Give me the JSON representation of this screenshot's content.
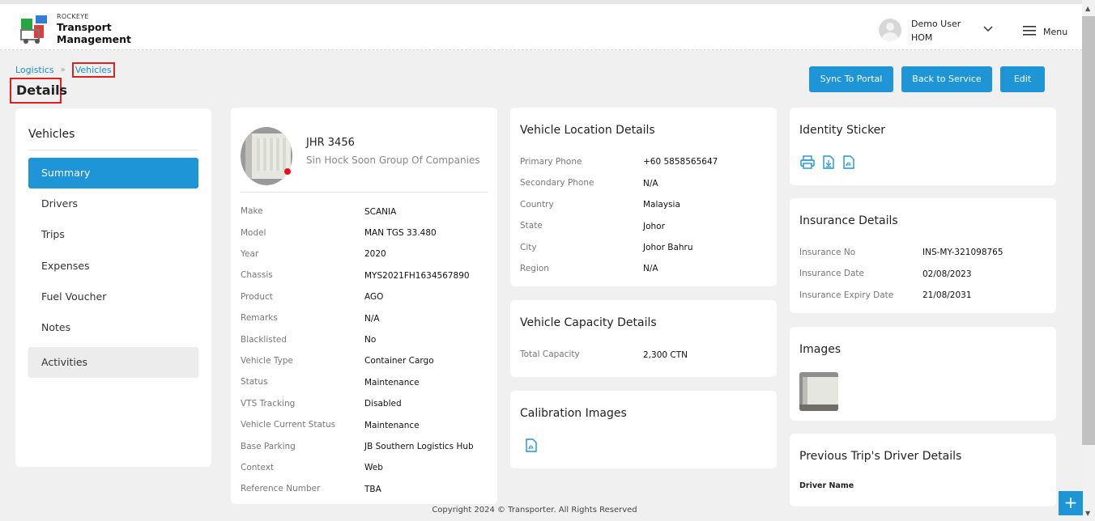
{
  "header": {
    "brand_small": "ROCKEYE",
    "brand_line1": "Transport",
    "brand_line2": "Management",
    "user_name": "Demo User",
    "user_role": "HOM",
    "menu_label": "Menu"
  },
  "breadcrumb": {
    "parent": "Logistics",
    "current": "Vehicles"
  },
  "page_title": "Details",
  "actions": {
    "sync": "Sync To Portal",
    "back": "Back to Service",
    "edit": "Edit"
  },
  "sidebar": {
    "title": "Vehicles",
    "items": [
      {
        "label": "Summary"
      },
      {
        "label": "Drivers"
      },
      {
        "label": "Trips"
      },
      {
        "label": "Expenses"
      },
      {
        "label": "Fuel Voucher"
      },
      {
        "label": "Notes"
      },
      {
        "label": "Activities"
      }
    ]
  },
  "vehicle": {
    "plate": "JHR 3456",
    "company": "Sin Hock Soon Group Of Companies",
    "rows": [
      {
        "label": "Make",
        "value": "SCANIA"
      },
      {
        "label": "Model",
        "value": "MAN TGS 33.480"
      },
      {
        "label": "Year",
        "value": "2020"
      },
      {
        "label": "Chassis",
        "value": "MYS2021FH1634567890"
      },
      {
        "label": "Product",
        "value": "AGO"
      },
      {
        "label": "Remarks",
        "value": "N/A"
      },
      {
        "label": "Blacklisted",
        "value": "No"
      },
      {
        "label": "Vehicle Type",
        "value": "Container Cargo"
      },
      {
        "label": "Status",
        "value": "Maintenance"
      },
      {
        "label": "VTS Tracking",
        "value": "Disabled"
      },
      {
        "label": "Vehicle Current Status",
        "value": "Maintenance"
      },
      {
        "label": "Base Parking",
        "value": "JB Southern Logistics Hub"
      },
      {
        "label": "Context",
        "value": "Web"
      },
      {
        "label": "Reference Number",
        "value": "TBA"
      }
    ]
  },
  "location": {
    "title": "Vehicle Location Details",
    "rows": [
      {
        "label": "Primary Phone",
        "value": "+60 5858565647"
      },
      {
        "label": "Secondary Phone",
        "value": "N/A"
      },
      {
        "label": "Country",
        "value": "Malaysia"
      },
      {
        "label": "State",
        "value": "Johor"
      },
      {
        "label": "City",
        "value": "Johor Bahru"
      },
      {
        "label": "Region",
        "value": "N/A"
      }
    ]
  },
  "capacity": {
    "title": "Vehicle Capacity Details",
    "rows": [
      {
        "label": "Total Capacity",
        "value": "2,300 CTN"
      }
    ]
  },
  "calibration": {
    "title": "Calibration Images"
  },
  "identity": {
    "title": "Identity Sticker"
  },
  "insurance": {
    "title": "Insurance Details",
    "rows": [
      {
        "label": "Insurance No",
        "value": "INS-MY-321098765"
      },
      {
        "label": "Insurance Date",
        "value": "02/08/2023"
      },
      {
        "label": "Insurance Expiry Date",
        "value": "21/08/2031"
      }
    ]
  },
  "images": {
    "title": "Images"
  },
  "previous_trip": {
    "title": "Previous Trip's Driver Details",
    "driver_label": "Driver Name"
  },
  "footer": {
    "text": "Copyright 2024 © Transporter. All Rights Reserved"
  },
  "colors": {
    "accent": "#1d95d6",
    "highlight": "#e02020",
    "status_dot": "#e8101a"
  },
  "icons": [
    "user-avatar-icon",
    "chevron-down-icon",
    "hamburger-menu-icon",
    "print-icon",
    "download-icon",
    "pdf-icon",
    "plus-icon"
  ]
}
